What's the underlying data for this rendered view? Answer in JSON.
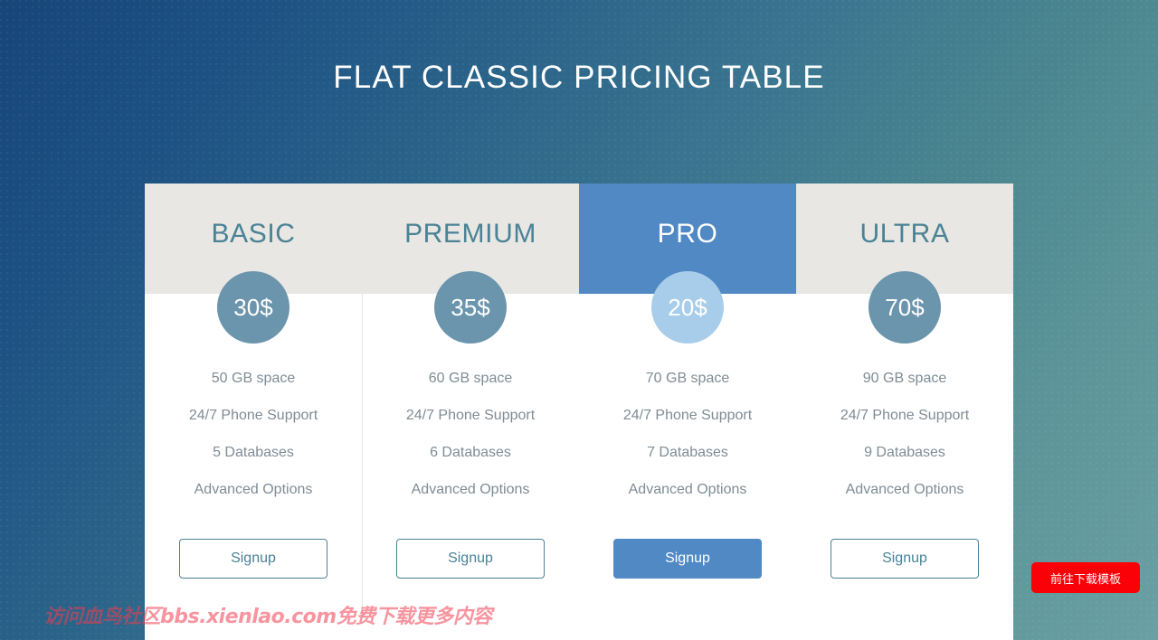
{
  "page": {
    "title": "FLAT CLASSIC PRICING TABLE",
    "background_start_color": "#17457a",
    "background_end_color": "#6aa0a3"
  },
  "pricing_table": {
    "accent_color": "#4a8296",
    "featured_color": "#5089c4",
    "header_background": "#e8e7e3",
    "badge_color": "#6b94ad",
    "featured_badge_color": "#a8cdea",
    "plans": [
      {
        "name": "BASIC",
        "price": "30$",
        "featured": false,
        "features": [
          "50 GB space",
          "24/7 Phone Support",
          "5 Databases",
          "Advanced Options"
        ],
        "cta_label": "Signup"
      },
      {
        "name": "PREMIUM",
        "price": "35$",
        "featured": false,
        "features": [
          "60 GB space",
          "24/7 Phone Support",
          "6 Databases",
          "Advanced Options"
        ],
        "cta_label": "Signup"
      },
      {
        "name": "PRO",
        "price": "20$",
        "featured": true,
        "features": [
          "70 GB space",
          "24/7 Phone Support",
          "7 Databases",
          "Advanced Options"
        ],
        "cta_label": "Signup"
      },
      {
        "name": "ULTRA",
        "price": "70$",
        "featured": false,
        "features": [
          "90 GB space",
          "24/7 Phone Support",
          "9 Databases",
          "Advanced Options"
        ],
        "cta_label": "Signup"
      }
    ]
  },
  "overlay": {
    "watermark": "访问血鸟社区bbs.xienlao.com免费下载更多内容",
    "download_button_label": "前往下载模板",
    "download_button_color": "#fa0007"
  }
}
